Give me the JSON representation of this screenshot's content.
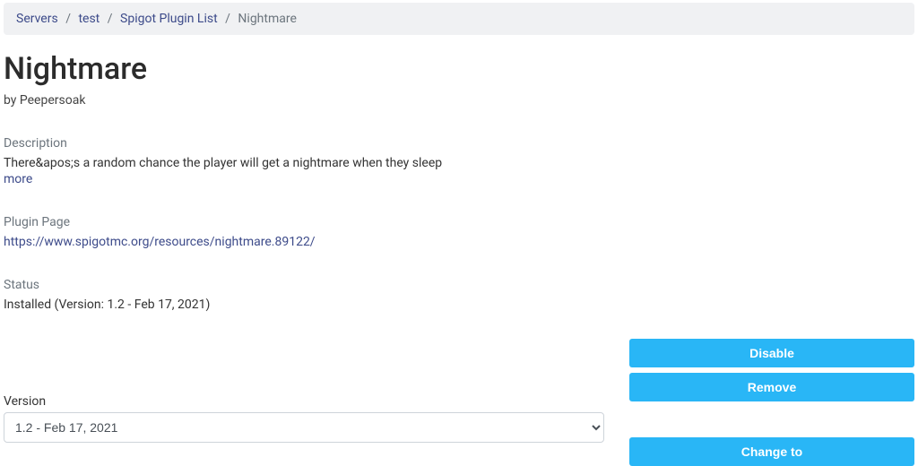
{
  "breadcrumb": {
    "items": [
      {
        "label": "Servers"
      },
      {
        "label": "test"
      },
      {
        "label": "Spigot Plugin List"
      }
    ],
    "current": "Nightmare"
  },
  "plugin": {
    "title": "Nightmare",
    "byline": "by Peepersoak",
    "description_label": "Description",
    "description_text": "There&apos;s a random chance the player will get a nightmare when they sleep",
    "more_label": "more",
    "page_label": "Plugin Page",
    "page_url": "https://www.spigotmc.org/resources/nightmare.89122/",
    "status_label": "Status",
    "status_text": "Installed (Version: 1.2 - Feb 17, 2021)"
  },
  "actions": {
    "disable": "Disable",
    "remove": "Remove",
    "change_to": "Change to"
  },
  "version": {
    "label": "Version",
    "selected": "1.2 - Feb 17, 2021"
  }
}
